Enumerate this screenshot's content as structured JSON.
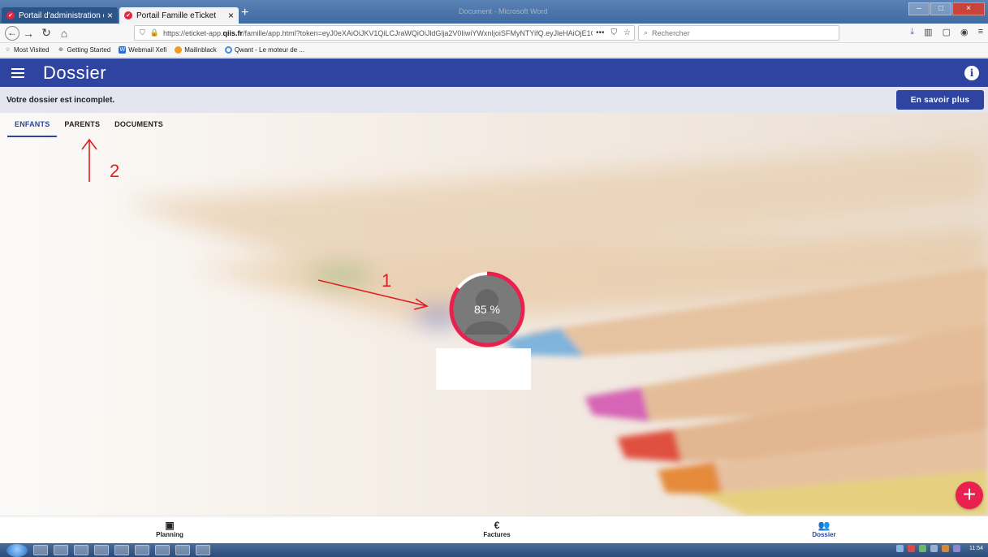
{
  "browser": {
    "tabs": [
      {
        "label": "Portail d'administration eTicket"
      },
      {
        "label": "Portail Famille eTicket"
      }
    ],
    "window_title": "Document - Microsoft Word",
    "url": {
      "prefix": "https://eticket-app.",
      "domain": "qiis.fr",
      "rest": "/famille/app.html?token=eyJ0eXAiOiJKV1QiLCJraWQiOiJldGlja2V0IiwiYWxnIjoiSFMyNTYifQ.eyJleHAiOjE1OTUzN"
    },
    "search_placeholder": "Rechercher",
    "bookmarks": [
      {
        "label": "Most Visited",
        "icon": "star-icon"
      },
      {
        "label": "Getting Started",
        "icon": "firefox-icon"
      },
      {
        "label": "Webmail Xefi",
        "icon": "mail-icon"
      },
      {
        "label": "Mailinblack",
        "icon": "mailinblack-icon"
      },
      {
        "label": "Qwant - Le moteur de ...",
        "icon": "qwant-icon"
      }
    ]
  },
  "app": {
    "title": "Dossier",
    "notice": "Votre dossier est incomplet.",
    "learn_more": "En savoir plus",
    "tabs": [
      {
        "label": "ENFANTS",
        "active": true
      },
      {
        "label": "PARENTS",
        "active": false
      },
      {
        "label": "DOCUMENTS",
        "active": false
      }
    ],
    "progress": {
      "value": 85,
      "label": "85 %"
    },
    "annotations": {
      "arrow1": "1",
      "arrow2": "2"
    },
    "bottom_nav": [
      {
        "label": "Planning",
        "icon": "calendar-icon",
        "active": false
      },
      {
        "label": "Factures",
        "icon": "euro-icon",
        "active": false
      },
      {
        "label": "Dossier",
        "icon": "people-icon",
        "active": true
      }
    ],
    "accent_color": "#2e44a0",
    "fab_color": "#e8214e"
  },
  "taskbar": {
    "clock": "11:54"
  }
}
